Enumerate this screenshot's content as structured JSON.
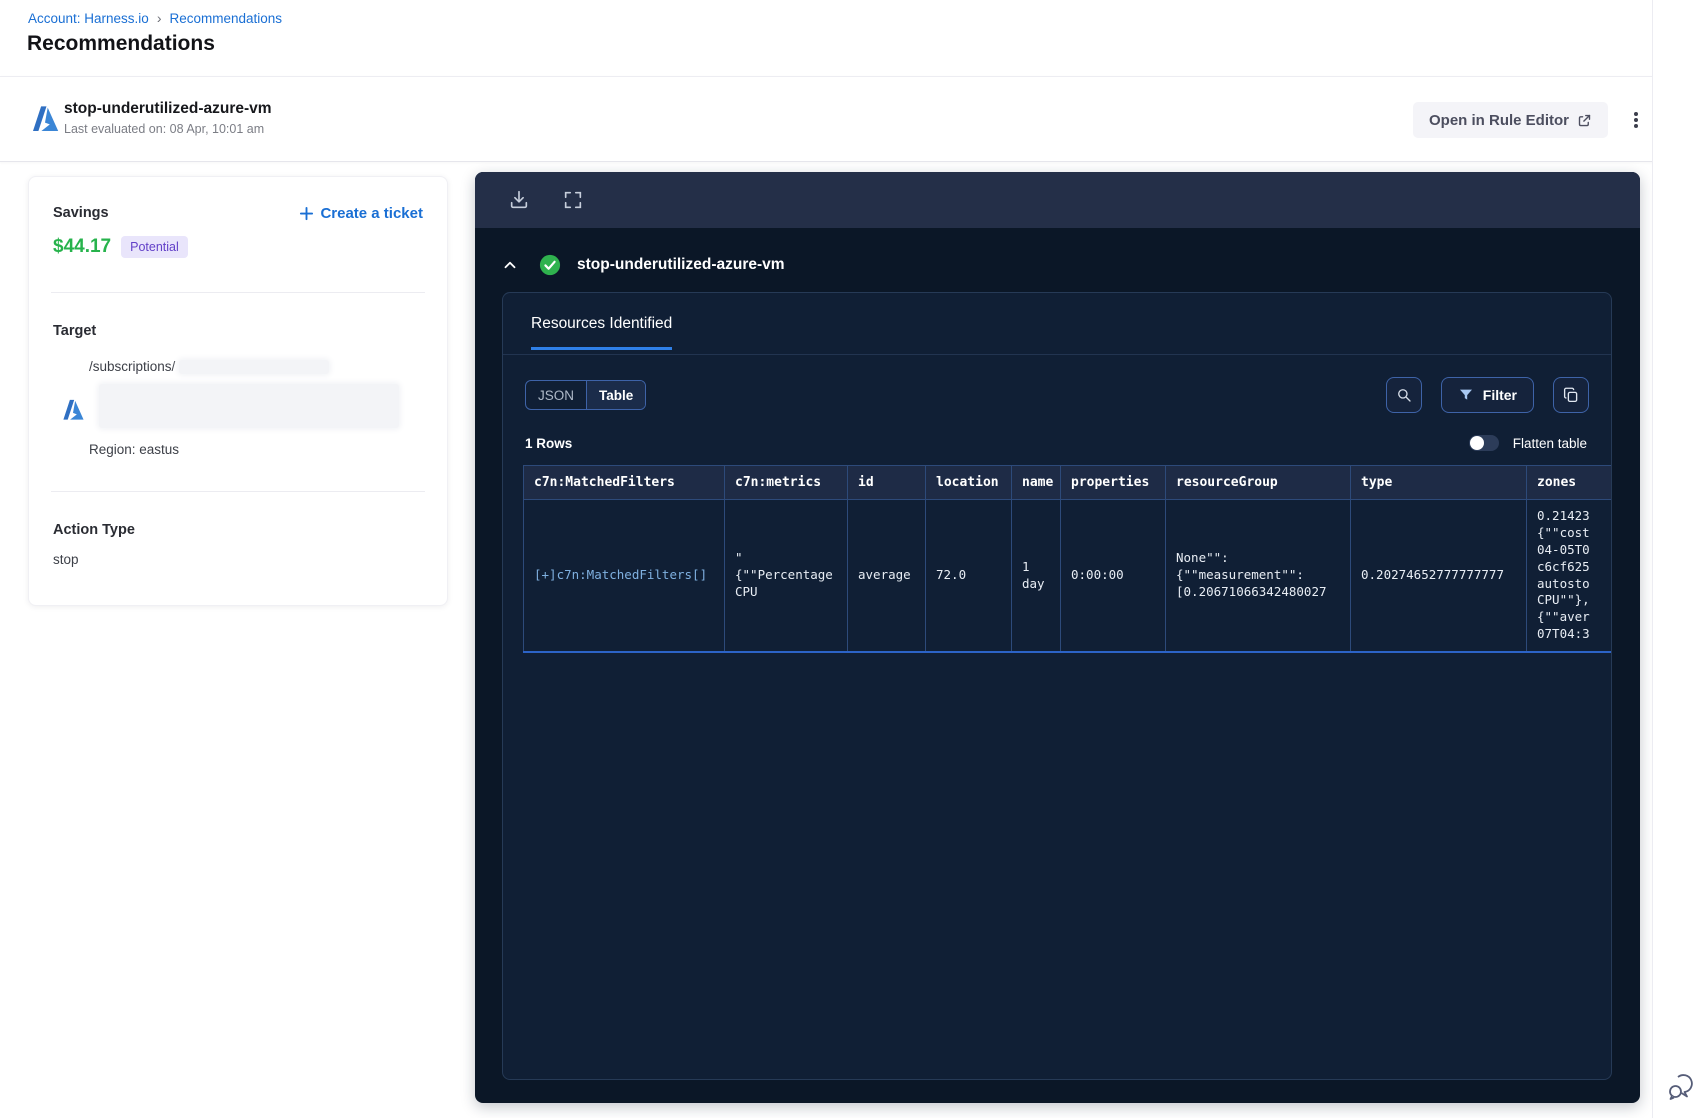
{
  "breadcrumb": {
    "account": "Account: Harness.io",
    "separator": "›",
    "page": "Recommendations"
  },
  "page_title": "Recommendations",
  "recommendation_header": {
    "title": "stop-underutilized-azure-vm",
    "last_evaluated": "Last evaluated on: 08 Apr, 10:01 am",
    "open_in_rule_editor": "Open in Rule Editor"
  },
  "summary_card": {
    "savings_label": "Savings",
    "savings_value": "$44.17",
    "savings_badge": "Potential",
    "create_ticket_label": "Create a ticket",
    "target_label": "Target",
    "target_path": "/subscriptions/",
    "region": "Region: eastus",
    "action_type_label": "Action Type",
    "action_type_value": "stop"
  },
  "resources_panel": {
    "recommendation_name": "stop-underutilized-azure-vm",
    "tab_label": "Resources Identified",
    "view_toggle": {
      "json_label": "JSON",
      "table_label": "Table",
      "active": "Table"
    },
    "filter_button_label": "Filter",
    "rows_count": "1 Rows",
    "flatten_toggle_label": "Flatten table",
    "flatten_toggle_state": "off"
  },
  "resources_table": {
    "columns": [
      "c7n:MatchedFilters",
      "c7n:metrics",
      "id",
      "location",
      "name",
      "properties",
      "resourceGroup",
      "type",
      "zones"
    ],
    "cells": [
      "[+]c7n:MatchedFilters[]",
      "\"\n{\"\"Percentage\nCPU",
      "average",
      "72.0",
      "1 day",
      "0:00:00",
      "None\"\":\n{\"\"measurement\"\":\n[0.20671066342480027",
      "0.20274652777777777",
      "0.21423\n{\"\"cost\n04-05T0\nc6cf625\nautosto\nCPU\"\"},\n{\"\"aver\n07T04:3"
    ]
  },
  "colors": {
    "link_blue": "#1a6fd4",
    "savings_green": "#27b34c",
    "badge_bg": "#e9e5fb",
    "badge_text": "#6240c8",
    "tab_accent": "#2f80e8",
    "check_green": "#2fb24e",
    "panel_bg": "#0b1727",
    "panel_toolbar_bg": "#242f48",
    "table_header_bg": "#1e2b46",
    "table_border": "#2d4a7a"
  }
}
